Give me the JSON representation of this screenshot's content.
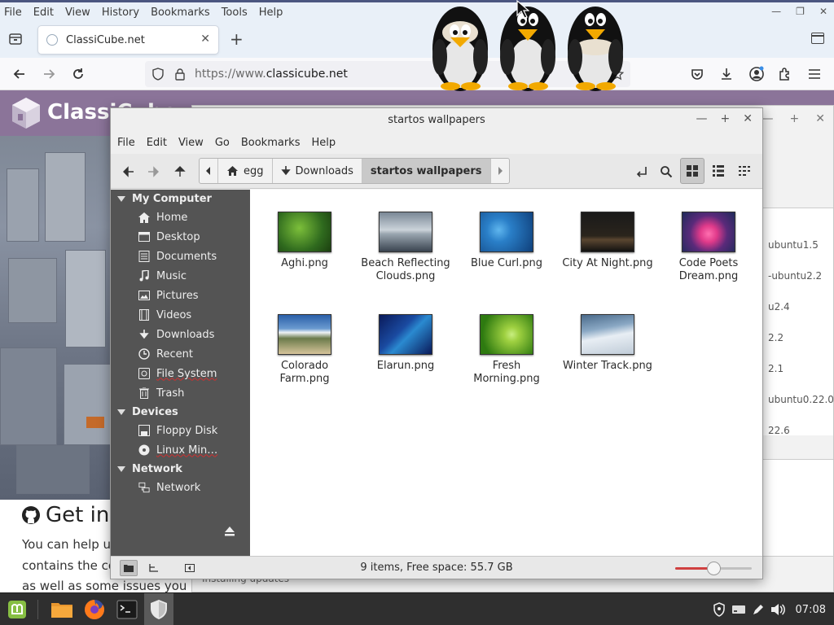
{
  "firefox": {
    "menu": [
      "File",
      "Edit",
      "View",
      "History",
      "Bookmarks",
      "Tools",
      "Help"
    ],
    "tab_title": "ClassiCube.net",
    "url_prefix": "https://www.",
    "url_domain": "classicube.net"
  },
  "site": {
    "logo_text": "ClassiCube",
    "heading": "Get inv",
    "para1": "You can help us",
    "para2": "contains the co",
    "para3": "as well as some issues you c"
  },
  "update_manager": {
    "rows": [
      "ubuntu1.5",
      "-ubuntu2.2",
      "u2.4",
      "2.2",
      "2.1",
      "ubuntu0.22.04.",
      "22.6"
    ],
    "status": "Installing updates"
  },
  "nemo": {
    "title": "startos wallpapers",
    "menu": [
      "File",
      "Edit",
      "View",
      "Go",
      "Bookmarks",
      "Help"
    ],
    "breadcrumbs": [
      "egg",
      "Downloads",
      "startos wallpapers"
    ],
    "sidebar": {
      "my_computer": "My Computer",
      "items": [
        "Home",
        "Desktop",
        "Documents",
        "Music",
        "Pictures",
        "Videos",
        "Downloads",
        "Recent",
        "File System",
        "Trash"
      ],
      "devices": "Devices",
      "device_items": [
        "Floppy Disk",
        "Linux Min…"
      ],
      "network": "Network",
      "network_items": [
        "Network"
      ]
    },
    "files": [
      {
        "name": "Aghi.png",
        "c1": "#2f6a1e",
        "c2": "#7cbf3a"
      },
      {
        "name": "Beach Reflecting Clouds.png",
        "c1": "#3a4450",
        "c2": "#c9d2da"
      },
      {
        "name": "Blue Curl.png",
        "c1": "#0f3f7a",
        "c2": "#3b8fd0"
      },
      {
        "name": "City At Night.png",
        "c1": "#101010",
        "c2": "#5a4630"
      },
      {
        "name": "Code Poets Dream.png",
        "c1": "#2a1a4a",
        "c2": "#e03a8a"
      },
      {
        "name": "Colorado Farm.png",
        "c1": "#2a5fa8",
        "c2": "#d6c49a"
      },
      {
        "name": "Elarun.png",
        "c1": "#0a1a5a",
        "c2": "#2a8ad0"
      },
      {
        "name": "Fresh Morning.png",
        "c1": "#2e7a10",
        "c2": "#9ed040"
      },
      {
        "name": "Winter Track.png",
        "c1": "#6f8fb0",
        "c2": "#e8eef4"
      }
    ],
    "status": "9 items, Free space: 55.7 GB",
    "zoom_level": 0.5
  },
  "taskbar": {
    "clock": "07:08"
  },
  "colors": {
    "nemo_sidebar": "#545454",
    "firefox_chrome": "#e9f0f8",
    "site_header": "#8b7499",
    "taskbar": "#2f2f2f"
  }
}
